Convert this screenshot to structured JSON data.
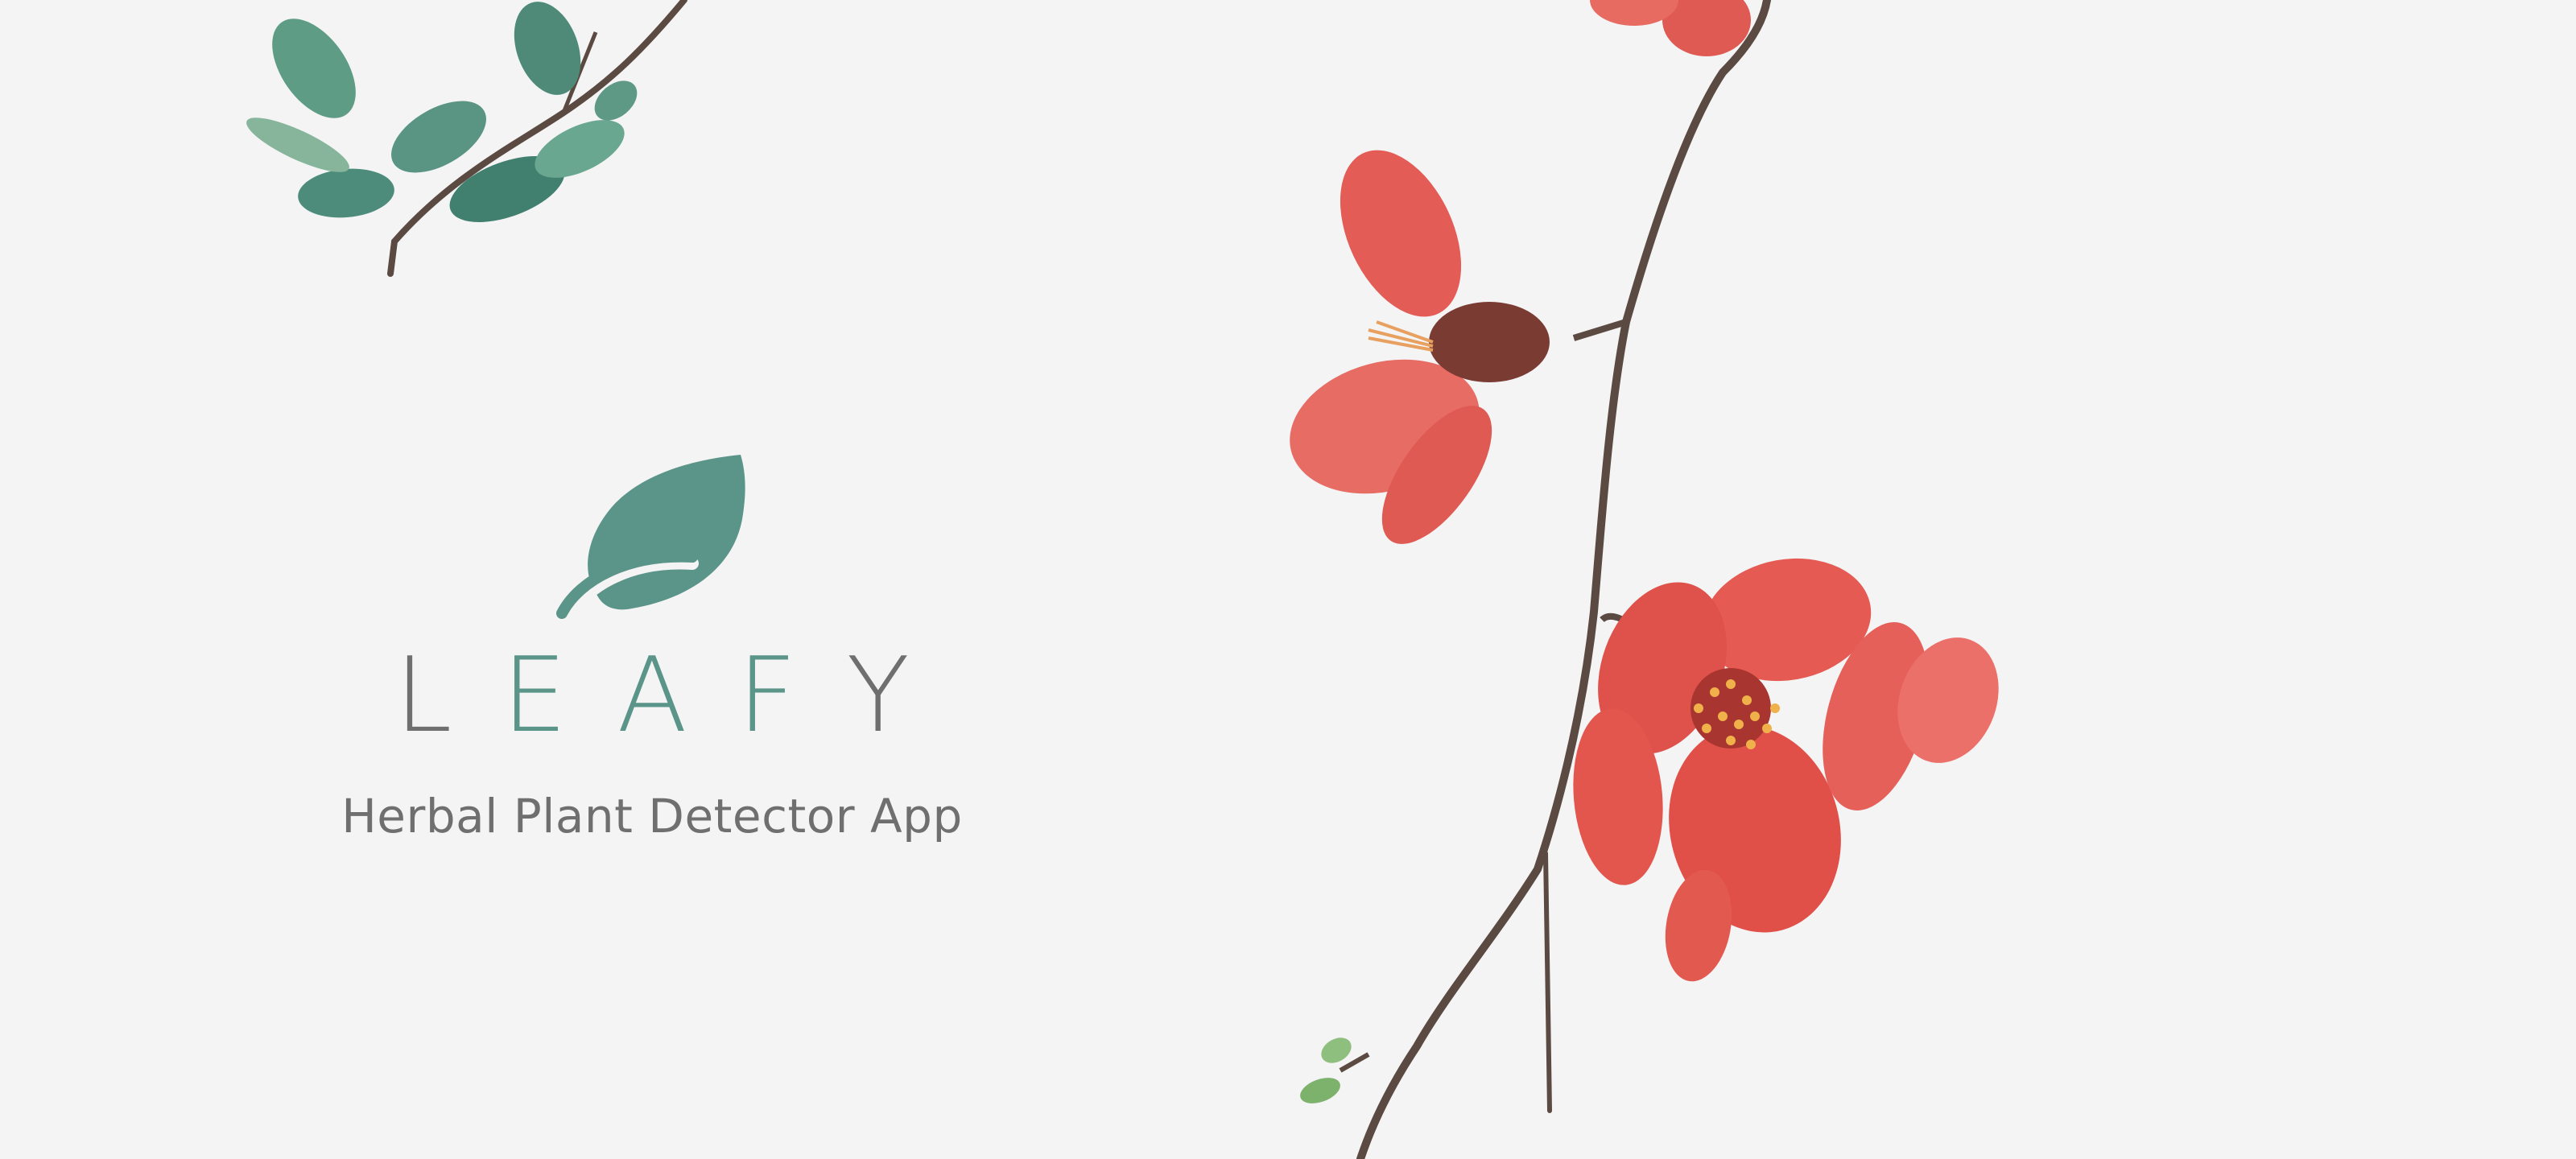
{
  "brand": {
    "name_letters": [
      "L",
      "E",
      "A",
      "F",
      "Y"
    ],
    "tagline": "Herbal Plant Detector App",
    "icon": "leaf-icon"
  },
  "decorations": {
    "top_left": "leafy-branch-illustration",
    "right": "red-quince-blossom-branch-illustration"
  },
  "colors": {
    "background": "#f4f4f5",
    "brand_green": "#5b9488",
    "text_gray": "#6f6f70",
    "blossom_red": "#e2574f",
    "stem_brown": "#5b4a42"
  }
}
